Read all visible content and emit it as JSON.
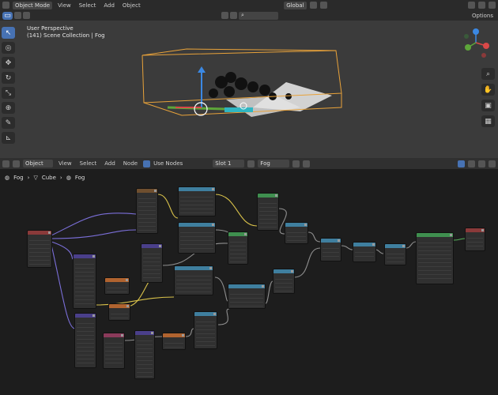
{
  "top_header": {
    "mode": "Object Mode",
    "menus": [
      "View",
      "Select",
      "Add",
      "Object"
    ],
    "orientation": "Global",
    "options": "Options"
  },
  "viewport": {
    "view_name": "User Perspective",
    "collection": "(141) Scene Collection | Fog"
  },
  "node_header": {
    "object": "Object",
    "menus": [
      "View",
      "Select",
      "Add",
      "Node"
    ],
    "use_nodes": "Use Nodes",
    "slot": "Slot 1",
    "material": "Fog"
  },
  "breadcrumb": {
    "items": [
      "Fog",
      "Cube",
      "Fog"
    ]
  },
  "gizmo_labels": [
    "Y",
    "X",
    "Z"
  ]
}
